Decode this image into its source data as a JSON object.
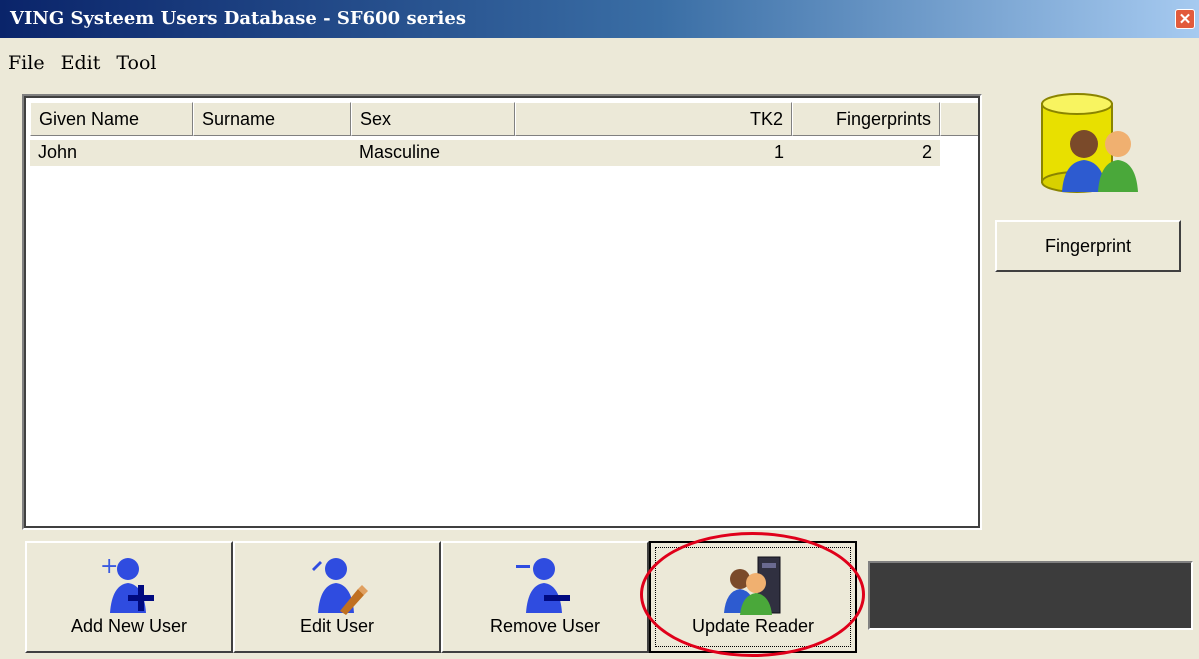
{
  "window": {
    "title": "VING Systeem Users Database - SF600 series"
  },
  "menu": {
    "file": "File",
    "edit": "Edit",
    "tool": "Tool"
  },
  "table": {
    "columns": [
      "Given Name",
      "Surname",
      "Sex",
      "TK2",
      "Fingerprints"
    ],
    "rows": [
      {
        "given_name": "John",
        "surname": "",
        "sex": "Masculine",
        "tk2": "1",
        "fingerprints": "2"
      }
    ]
  },
  "side": {
    "fingerprint_button": "Fingerprint"
  },
  "toolbar": {
    "add_new_user": "Add New User",
    "edit_user": "Edit User",
    "remove_user": "Remove User",
    "update_reader": "Update Reader"
  },
  "icons": [
    "close-icon",
    "database-users-icon",
    "add-user-icon",
    "edit-user-icon",
    "remove-user-icon",
    "update-reader-icon"
  ],
  "colors": {
    "title_gradient_start": "#0a246a",
    "highlight_oval": "#e0001a",
    "status_panel": "#3c3c3c"
  }
}
